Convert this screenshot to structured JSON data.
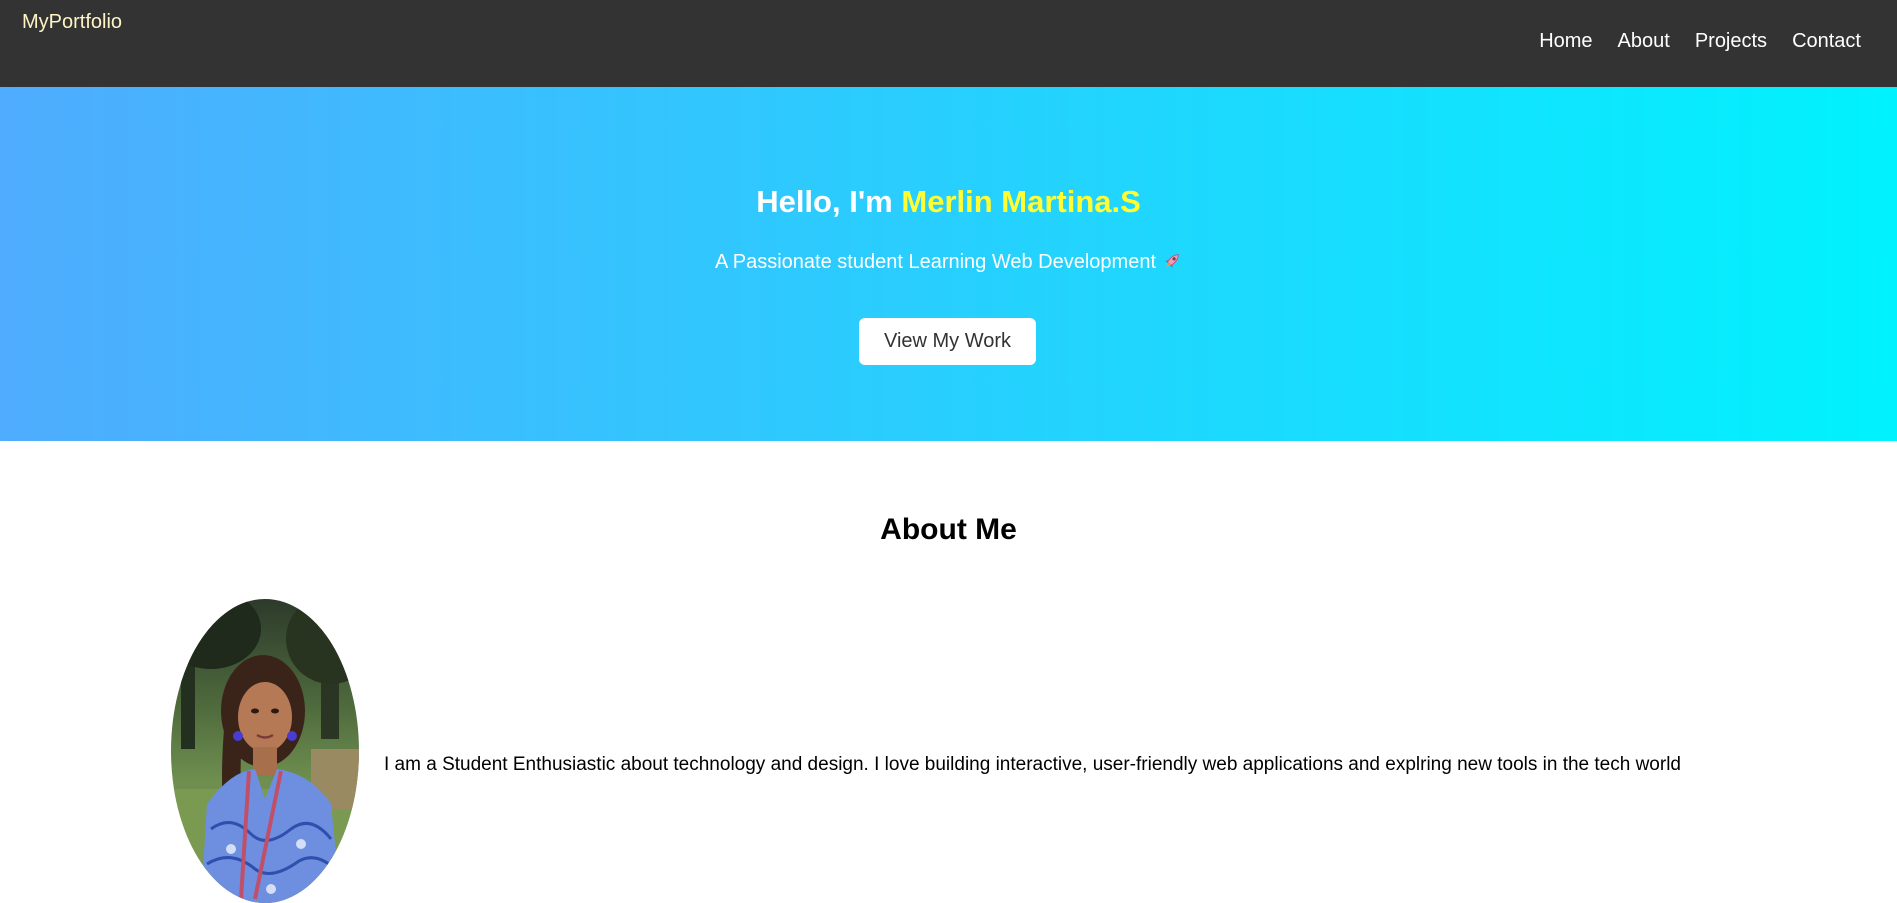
{
  "navbar": {
    "brand": "MyPortfolio",
    "links": [
      "Home",
      "About",
      "Projects",
      "Contact"
    ]
  },
  "hero": {
    "greeting": "Hello, I'm ",
    "name": "Merlin Martina.S",
    "subtitle": "A Passionate student Learning Web Development",
    "subtitle_icon": "rocket-icon",
    "cta_label": "View My Work"
  },
  "about": {
    "title": "About Me",
    "text": "I am a Student Enthusiastic about technology and design. I love building interactive, user-friendly web applications and explring new tools in the tech world"
  },
  "colors": {
    "navbar_bg": "#333333",
    "brand": "#fff3c4",
    "hero_gradient_start": "#4facfe",
    "hero_gradient_end": "#00f2fe",
    "name_highlight": "#ffff33"
  }
}
